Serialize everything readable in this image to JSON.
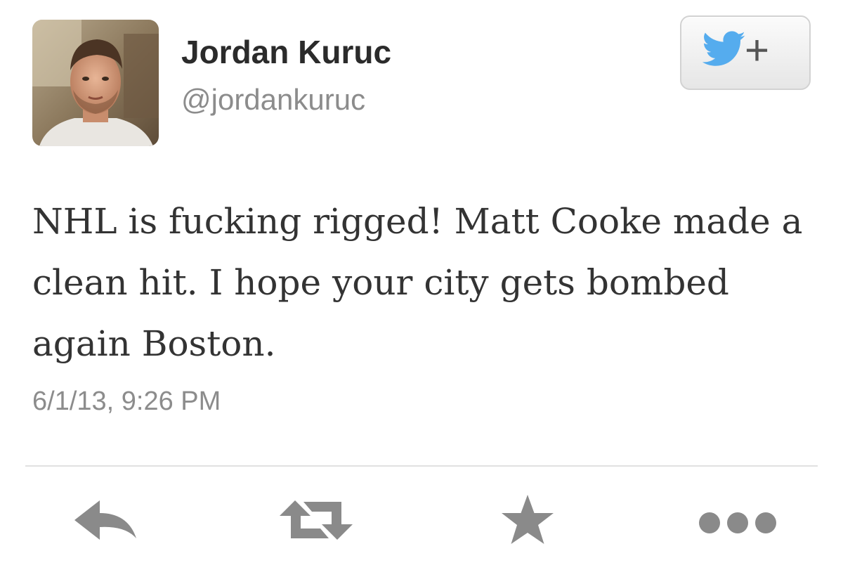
{
  "tweet": {
    "author": {
      "display_name": "Jordan Kuruc",
      "handle": "@jordankuruc",
      "avatar_icon": "profile-photo"
    },
    "follow_button": {
      "icon": "twitter-bird-icon",
      "label": "+",
      "bird_color": "#55acee"
    },
    "text": "NHL is fucking rigged! Matt Cooke made a clean hit. I hope your city gets bombed again Boston.",
    "timestamp": "6/1/13, 9:26 PM",
    "actions": [
      {
        "name": "reply",
        "icon": "reply-arrow-icon"
      },
      {
        "name": "retweet",
        "icon": "retweet-icon"
      },
      {
        "name": "favorite",
        "icon": "star-icon"
      },
      {
        "name": "more",
        "icon": "ellipsis-icon"
      }
    ],
    "colors": {
      "text": "#333333",
      "secondary_text": "#8c8c8c",
      "action_icons": "#8a8a8a",
      "divider": "#e1e1e1"
    }
  }
}
